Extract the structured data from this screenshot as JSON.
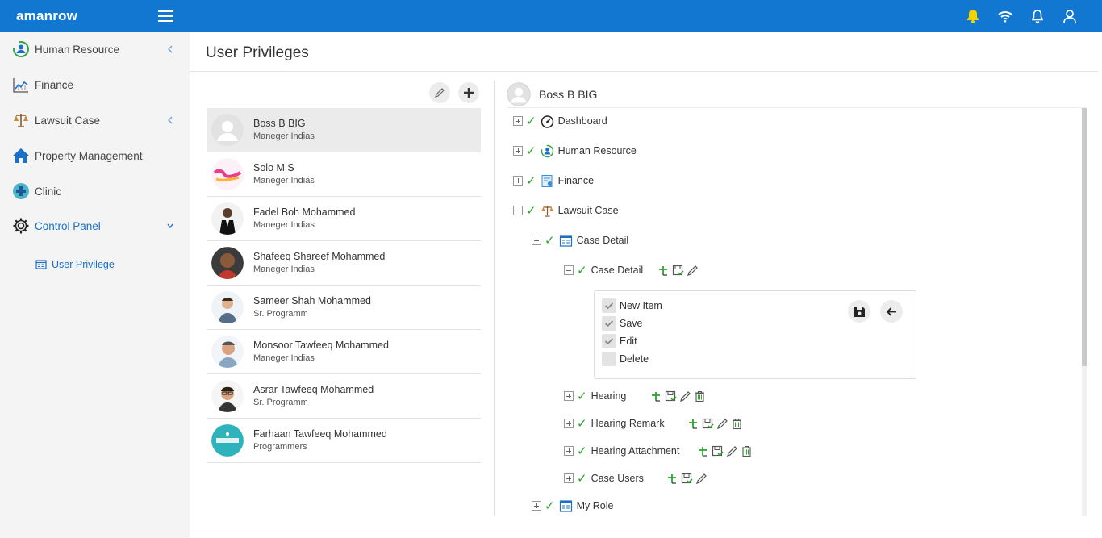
{
  "app": {
    "logo": "amanrow"
  },
  "sidebar": {
    "items": [
      {
        "label": "Human Resource"
      },
      {
        "label": "Finance"
      },
      {
        "label": "Lawsuit Case"
      },
      {
        "label": "Property Management"
      },
      {
        "label": "Clinic"
      },
      {
        "label": "Control Panel"
      }
    ],
    "sub_items": [
      {
        "label": "User Privilege"
      }
    ]
  },
  "page": {
    "title": "User Privileges"
  },
  "users": [
    {
      "name": "Boss B BIG",
      "role": "Maneger Indias"
    },
    {
      "name": "Solo M S",
      "role": "Maneger Indias"
    },
    {
      "name": "Fadel Boh Mohammed",
      "role": "Maneger Indias"
    },
    {
      "name": "Shafeeq Shareef Mohammed",
      "role": "Maneger Indias"
    },
    {
      "name": "Sameer Shah Mohammed",
      "role": "Sr. Programm"
    },
    {
      "name": "Monsoor Tawfeeq Mohammed",
      "role": "Maneger Indias"
    },
    {
      "name": "Asrar Tawfeeq Mohammed",
      "role": "Sr. Programm"
    },
    {
      "name": "Farhaan Tawfeeq Mohammed",
      "role": "Programmers"
    }
  ],
  "detail": {
    "user_name": "Boss B BIG",
    "tree": {
      "dashboard": "Dashboard",
      "human_resource": "Human Resource",
      "finance": "Finance",
      "lawsuit_case": "Lawsuit Case",
      "case_detail_group": "Case Detail",
      "case_detail": "Case Detail",
      "hearing": "Hearing",
      "hearing_remark": "Hearing Remark",
      "hearing_attachment": "Hearing Attachment",
      "case_users": "Case Users",
      "my_role": "My Role"
    },
    "permissions": [
      {
        "label": "New Item",
        "checked": true
      },
      {
        "label": "Save",
        "checked": true
      },
      {
        "label": "Edit",
        "checked": true
      },
      {
        "label": "Delete",
        "checked": false
      }
    ]
  },
  "colors": {
    "topbar": "#1177d1",
    "accent": "#1a6fc9",
    "check": "#2aa52a",
    "bell": "#f7d300"
  }
}
